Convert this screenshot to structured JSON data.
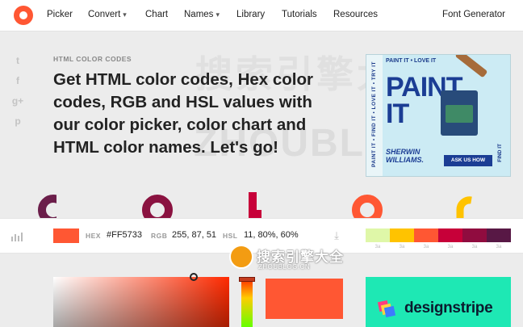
{
  "nav": {
    "items": [
      {
        "label": "Picker"
      },
      {
        "label": "Convert",
        "has_caret": true
      },
      {
        "label": "Chart"
      },
      {
        "label": "Names",
        "has_caret": true
      },
      {
        "label": "Library"
      },
      {
        "label": "Tutorials"
      },
      {
        "label": "Resources"
      }
    ],
    "right_label": "Font Generator",
    "caret_glyph": "▾"
  },
  "social": [
    {
      "icon": "twitter-icon",
      "glyph": "t"
    },
    {
      "icon": "facebook-icon",
      "glyph": "f"
    },
    {
      "icon": "google-plus-icon",
      "glyph": "g+"
    },
    {
      "icon": "pinterest-icon",
      "glyph": "p"
    }
  ],
  "hero": {
    "eyebrow": "HTML COLOR CODES",
    "headline": "Get HTML color codes, Hex color codes, RGB and HSL values with our color picker, color chart and HTML color names. Let's go!"
  },
  "watermark": {
    "big": "ZHOUBLOG.CN",
    "cn_big": "搜索引擎大全",
    "cn": "搜索引擎大全",
    "url": "ZHOUBLOG.CN"
  },
  "ad_top": {
    "side_text": "PAINT IT • FIND IT • LOVE IT • TRY IT",
    "top_text": "PAINT IT • LOVE IT",
    "title_line1": "PAINT",
    "title_line2": "IT",
    "brand_line1": "SHERWIN",
    "brand_line2": "WILLIAMS.",
    "cta": "ASK US HOW",
    "right_text": "FIND IT"
  },
  "toolbar": {
    "hex_label": "HEX",
    "hex_value": "#FF5733",
    "rgb_label": "RGB",
    "rgb_value": "255, 87, 51",
    "hsl_label": "HSL",
    "hsl_value": "11, 80%, 60%",
    "swatch_color": "#FF5733"
  },
  "palette": {
    "colors": [
      "#dff7a8",
      "#ffc300",
      "#ff5733",
      "#c70039",
      "#900c3f",
      "#581845"
    ],
    "labels": [
      "3a",
      "3a",
      "3a",
      "3a",
      "3a",
      "3a"
    ]
  },
  "ad_bottom": {
    "brand": "designstripe"
  },
  "colors": {
    "accent": "#ff5733",
    "deco": [
      "#6b1e4a",
      "#8a1240",
      "#c70039",
      "#ff5733",
      "#ffc300"
    ]
  }
}
